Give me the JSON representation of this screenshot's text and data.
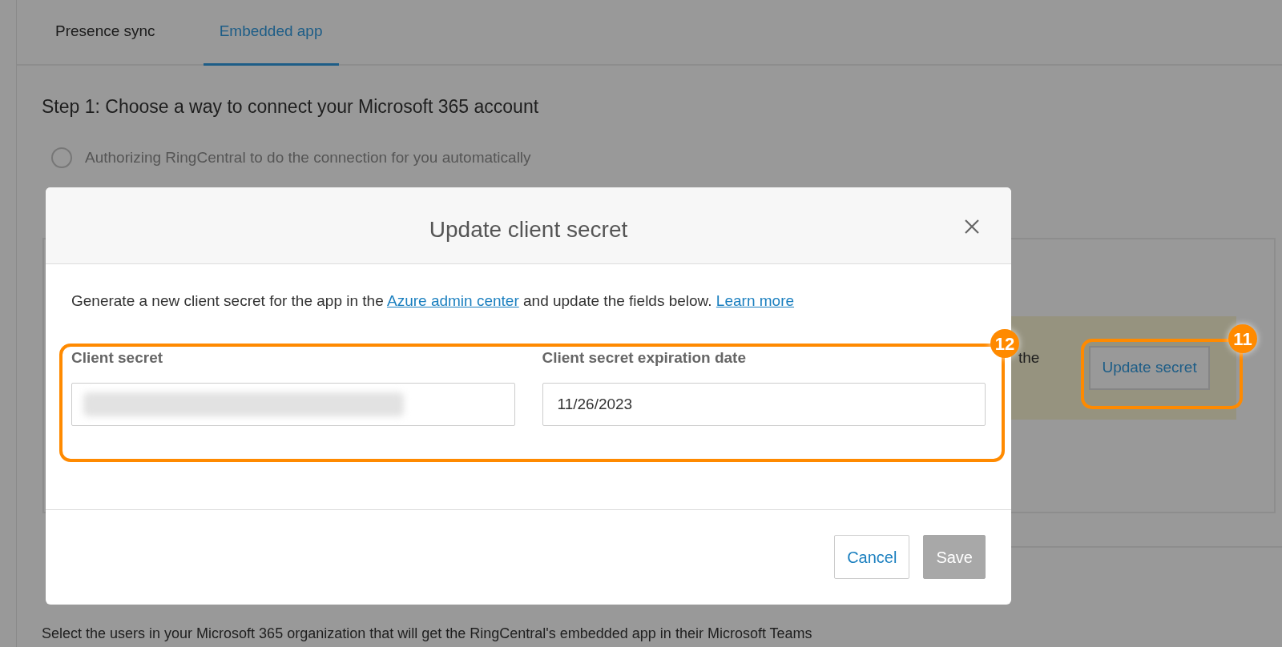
{
  "tabs": [
    {
      "label": "Presence sync",
      "selected": false
    },
    {
      "label": "Embedded app",
      "selected": true
    }
  ],
  "step1": {
    "heading": "Step 1: Choose a way to connect your Microsoft 365 account",
    "options": [
      {
        "label": "Authorizing RingCentral to do the connection for you automatically",
        "selected": false
      }
    ]
  },
  "background_panel": {
    "partial_text": "the",
    "button": "Update secret"
  },
  "step2": {
    "description": "Select the users in your Microsoft 365 organization that will get the RingCentral's embedded app in their Microsoft Teams"
  },
  "dialog": {
    "title": "Update client secret",
    "description": [
      {
        "text": "Generate a new client secret for the app in the ",
        "link": false
      },
      {
        "text": "Azure admin center",
        "link": true
      },
      {
        "text": " and update the fields below. ",
        "link": false
      },
      {
        "text": "Learn more",
        "link": true
      }
    ],
    "fields": [
      {
        "label": "Client secret",
        "kind": "redacted"
      },
      {
        "label": "Client secret expiration date",
        "kind": "text",
        "value": "11/26/2023"
      }
    ],
    "buttons": [
      {
        "label": "Cancel",
        "disabled": false
      },
      {
        "label": "Save",
        "disabled": true
      }
    ]
  },
  "annotations": [
    {
      "number": "12"
    },
    {
      "number": "11"
    }
  ]
}
